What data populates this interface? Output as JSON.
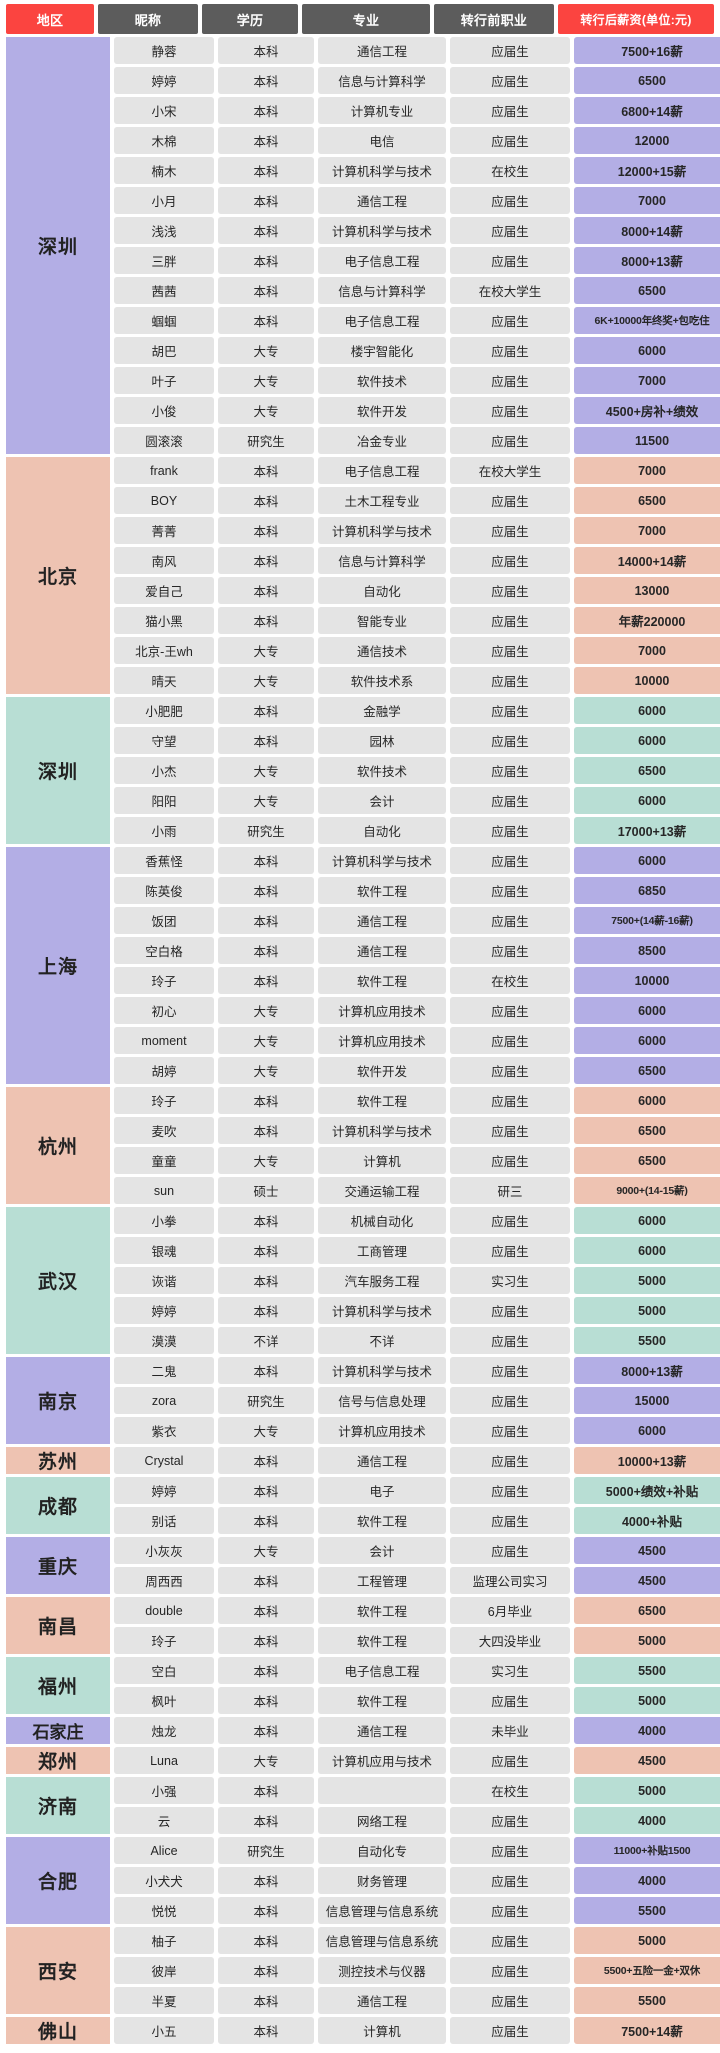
{
  "table": {
    "headers": {
      "region": "地区",
      "nickname": "昵称",
      "education": "学历",
      "major": "专业",
      "previous_job": "转行前职业",
      "salary": "转行后薪资(单位:元)"
    },
    "colors": {
      "header_dark": "#5c5c5c",
      "header_red": "#fb4440",
      "cell_gray": "#e4e4e4",
      "purple": "#b3aee5",
      "peach": "#eec3b2",
      "mint": "#b8ded4"
    },
    "groups": [
      {
        "region": "深圳",
        "color": "#b3aee5",
        "rows": [
          {
            "nickname": "静蓉",
            "education": "本科",
            "major": "通信工程",
            "previous_job": "应届生",
            "salary": "7500+16薪"
          },
          {
            "nickname": "婷婷",
            "education": "本科",
            "major": "信息与计算科学",
            "previous_job": "应届生",
            "salary": "6500"
          },
          {
            "nickname": "小宋",
            "education": "本科",
            "major": "计算机专业",
            "previous_job": "应届生",
            "salary": "6800+14薪"
          },
          {
            "nickname": "木棉",
            "education": "本科",
            "major": "电信",
            "previous_job": "应届生",
            "salary": "12000"
          },
          {
            "nickname": "楠木",
            "education": "本科",
            "major": "计算机科学与技术",
            "previous_job": "在校生",
            "salary": "12000+15薪"
          },
          {
            "nickname": "小月",
            "education": "本科",
            "major": "通信工程",
            "previous_job": "应届生",
            "salary": "7000"
          },
          {
            "nickname": "浅浅",
            "education": "本科",
            "major": "计算机科学与技术",
            "previous_job": "应届生",
            "salary": "8000+14薪"
          },
          {
            "nickname": "三胖",
            "education": "本科",
            "major": "电子信息工程",
            "previous_job": "应届生",
            "salary": "8000+13薪"
          },
          {
            "nickname": "茜茜",
            "education": "本科",
            "major": "信息与计算科学",
            "previous_job": "在校大学生",
            "salary": "6500"
          },
          {
            "nickname": "蝈蝈",
            "education": "本科",
            "major": "电子信息工程",
            "previous_job": "应届生",
            "salary": "6K+10000年终奖+包吃住"
          },
          {
            "nickname": "胡巴",
            "education": "大专",
            "major": "楼宇智能化",
            "previous_job": "应届生",
            "salary": "6000"
          },
          {
            "nickname": "叶子",
            "education": "大专",
            "major": "软件技术",
            "previous_job": "应届生",
            "salary": "7000"
          },
          {
            "nickname": "小俊",
            "education": "大专",
            "major": "软件开发",
            "previous_job": "应届生",
            "salary": "4500+房补+绩效"
          },
          {
            "nickname": "圆滚滚",
            "education": "研究生",
            "major": "冶金专业",
            "previous_job": "应届生",
            "salary": "11500"
          }
        ]
      },
      {
        "region": "北京",
        "color": "#eec3b2",
        "rows": [
          {
            "nickname": "frank",
            "education": "本科",
            "major": "电子信息工程",
            "previous_job": "在校大学生",
            "salary": "7000"
          },
          {
            "nickname": "BOY",
            "education": "本科",
            "major": "土木工程专业",
            "previous_job": "应届生",
            "salary": "6500"
          },
          {
            "nickname": "菁菁",
            "education": "本科",
            "major": "计算机科学与技术",
            "previous_job": "应届生",
            "salary": "7000"
          },
          {
            "nickname": "南风",
            "education": "本科",
            "major": "信息与计算科学",
            "previous_job": "应届生",
            "salary": "14000+14薪"
          },
          {
            "nickname": "爱自己",
            "education": "本科",
            "major": "自动化",
            "previous_job": "应届生",
            "salary": "13000"
          },
          {
            "nickname": "猫小黑",
            "education": "本科",
            "major": "智能专业",
            "previous_job": "应届生",
            "salary": "年薪220000"
          },
          {
            "nickname": "北京-王wh",
            "education": "大专",
            "major": "通信技术",
            "previous_job": "应届生",
            "salary": "7000"
          },
          {
            "nickname": "晴天",
            "education": "大专",
            "major": "软件技术系",
            "previous_job": "应届生",
            "salary": "10000"
          }
        ]
      },
      {
        "region": "深圳",
        "color": "#b8ded4",
        "rows": [
          {
            "nickname": "小肥肥",
            "education": "本科",
            "major": "金融学",
            "previous_job": "应届生",
            "salary": "6000"
          },
          {
            "nickname": "守望",
            "education": "本科",
            "major": "园林",
            "previous_job": "应届生",
            "salary": "6000"
          },
          {
            "nickname": "小杰",
            "education": "大专",
            "major": "软件技术",
            "previous_job": "应届生",
            "salary": "6500"
          },
          {
            "nickname": "阳阳",
            "education": "大专",
            "major": "会计",
            "previous_job": "应届生",
            "salary": "6000"
          },
          {
            "nickname": "小雨",
            "education": "研究生",
            "major": "自动化",
            "previous_job": "应届生",
            "salary": "17000+13薪"
          }
        ]
      },
      {
        "region": "上海",
        "color": "#b3aee5",
        "rows": [
          {
            "nickname": "香蕉怪",
            "education": "本科",
            "major": "计算机科学与技术",
            "previous_job": "应届生",
            "salary": "6000"
          },
          {
            "nickname": "陈英俊",
            "education": "本科",
            "major": "软件工程",
            "previous_job": "应届生",
            "salary": "6850"
          },
          {
            "nickname": "饭团",
            "education": "本科",
            "major": "通信工程",
            "previous_job": "应届生",
            "salary": "7500+(14薪-16薪)"
          },
          {
            "nickname": "空白格",
            "education": "本科",
            "major": "通信工程",
            "previous_job": "应届生",
            "salary": "8500"
          },
          {
            "nickname": "玲子",
            "education": "本科",
            "major": "软件工程",
            "previous_job": "在校生",
            "salary": "10000"
          },
          {
            "nickname": "初心",
            "education": "大专",
            "major": "计算机应用技术",
            "previous_job": "应届生",
            "salary": "6000"
          },
          {
            "nickname": "moment",
            "education": "大专",
            "major": "计算机应用技术",
            "previous_job": "应届生",
            "salary": "6000"
          },
          {
            "nickname": "胡婷",
            "education": "大专",
            "major": "软件开发",
            "previous_job": "应届生",
            "salary": "6500"
          }
        ]
      },
      {
        "region": "杭州",
        "color": "#eec3b2",
        "rows": [
          {
            "nickname": "玲子",
            "education": "本科",
            "major": "软件工程",
            "previous_job": "应届生",
            "salary": "6000"
          },
          {
            "nickname": "麦吹",
            "education": "本科",
            "major": "计算机科学与技术",
            "previous_job": "应届生",
            "salary": "6500"
          },
          {
            "nickname": "童童",
            "education": "大专",
            "major": "计算机",
            "previous_job": "应届生",
            "salary": "6500"
          },
          {
            "nickname": "sun",
            "education": "硕士",
            "major": "交通运输工程",
            "previous_job": "研三",
            "salary": "9000+(14-15薪)"
          }
        ]
      },
      {
        "region": "武汉",
        "color": "#b8ded4",
        "rows": [
          {
            "nickname": "小拳",
            "education": "本科",
            "major": "机械自动化",
            "previous_job": "应届生",
            "salary": "6000"
          },
          {
            "nickname": "银魂",
            "education": "本科",
            "major": "工商管理",
            "previous_job": "应届生",
            "salary": "6000"
          },
          {
            "nickname": "诙谐",
            "education": "本科",
            "major": "汽车服务工程",
            "previous_job": "实习生",
            "salary": "5000"
          },
          {
            "nickname": "婷婷",
            "education": "本科",
            "major": "计算机科学与技术",
            "previous_job": "应届生",
            "salary": "5000"
          },
          {
            "nickname": "漠漠",
            "education": "不详",
            "major": "不详",
            "previous_job": "应届生",
            "salary": "5500"
          }
        ]
      },
      {
        "region": "南京",
        "color": "#b3aee5",
        "rows": [
          {
            "nickname": "二鬼",
            "education": "本科",
            "major": "计算机科学与技术",
            "previous_job": "应届生",
            "salary": "8000+13薪"
          },
          {
            "nickname": "zora",
            "education": "研究生",
            "major": "信号与信息处理",
            "previous_job": "应届生",
            "salary": "15000"
          },
          {
            "nickname": "紫衣",
            "education": "大专",
            "major": "计算机应用技术",
            "previous_job": "应届生",
            "salary": "6000"
          }
        ]
      },
      {
        "region": "苏州",
        "color": "#eec3b2",
        "rows": [
          {
            "nickname": "Crystal",
            "education": "本科",
            "major": "通信工程",
            "previous_job": "应届生",
            "salary": "10000+13薪"
          }
        ]
      },
      {
        "region": "成都",
        "color": "#b8ded4",
        "rows": [
          {
            "nickname": "婷婷",
            "education": "本科",
            "major": "电子",
            "previous_job": "应届生",
            "salary": "5000+绩效+补贴"
          },
          {
            "nickname": "别话",
            "education": "本科",
            "major": "软件工程",
            "previous_job": "应届生",
            "salary": "4000+补贴"
          }
        ]
      },
      {
        "region": "重庆",
        "color": "#b3aee5",
        "rows": [
          {
            "nickname": "小灰灰",
            "education": "大专",
            "major": "会计",
            "previous_job": "应届生",
            "salary": "4500"
          },
          {
            "nickname": "周西西",
            "education": "本科",
            "major": "工程管理",
            "previous_job": "监理公司实习",
            "salary": "4500"
          }
        ]
      },
      {
        "region": "南昌",
        "color": "#eec3b2",
        "rows": [
          {
            "nickname": "double",
            "education": "本科",
            "major": "软件工程",
            "previous_job": "6月毕业",
            "salary": "6500"
          },
          {
            "nickname": "玲子",
            "education": "本科",
            "major": "软件工程",
            "previous_job": "大四没毕业",
            "salary": "5000"
          }
        ]
      },
      {
        "region": "福州",
        "color": "#b8ded4",
        "rows": [
          {
            "nickname": "空白",
            "education": "本科",
            "major": "电子信息工程",
            "previous_job": "实习生",
            "salary": "5500"
          },
          {
            "nickname": "枫叶",
            "education": "本科",
            "major": "软件工程",
            "previous_job": "应届生",
            "salary": "5000"
          }
        ]
      },
      {
        "region": "石家庄",
        "color": "#b3aee5",
        "rows": [
          {
            "nickname": "烛龙",
            "education": "本科",
            "major": "通信工程",
            "previous_job": "未毕业",
            "salary": "4000"
          }
        ]
      },
      {
        "region": "郑州",
        "color": "#eec3b2",
        "rows": [
          {
            "nickname": "Luna",
            "education": "大专",
            "major": "计算机应用与技术",
            "previous_job": "应届生",
            "salary": "4500"
          }
        ]
      },
      {
        "region": "济南",
        "color": "#b8ded4",
        "rows": [
          {
            "nickname": "小强",
            "education": "本科",
            "major": "",
            "previous_job": "在校生",
            "salary": "5000"
          },
          {
            "nickname": "云",
            "education": "本科",
            "major": "网络工程",
            "previous_job": "应届生",
            "salary": "4000"
          }
        ]
      },
      {
        "region": "合肥",
        "color": "#b3aee5",
        "rows": [
          {
            "nickname": "Alice",
            "education": "研究生",
            "major": "自动化专",
            "previous_job": "应届生",
            "salary": "11000+补贴1500"
          },
          {
            "nickname": "小犬犬",
            "education": "本科",
            "major": "财务管理",
            "previous_job": "应届生",
            "salary": "4000"
          },
          {
            "nickname": "悦悦",
            "education": "本科",
            "major": "信息管理与信息系统",
            "previous_job": "应届生",
            "salary": "5500"
          }
        ]
      },
      {
        "region": "西安",
        "color": "#eec3b2",
        "rows": [
          {
            "nickname": "柚子",
            "education": "本科",
            "major": "信息管理与信息系统",
            "previous_job": "应届生",
            "salary": "5000"
          },
          {
            "nickname": "彼岸",
            "education": "本科",
            "major": "测控技术与仪器",
            "previous_job": "应届生",
            "salary": "5500+五险一金+双休"
          },
          {
            "nickname": "半夏",
            "education": "本科",
            "major": "通信工程",
            "previous_job": "应届生",
            "salary": "5500"
          }
        ]
      },
      {
        "region": "佛山",
        "color": "#eec3b2",
        "rows": [
          {
            "nickname": "小五",
            "education": "本科",
            "major": "计算机",
            "previous_job": "应届生",
            "salary": "7500+14薪"
          }
        ]
      }
    ]
  }
}
